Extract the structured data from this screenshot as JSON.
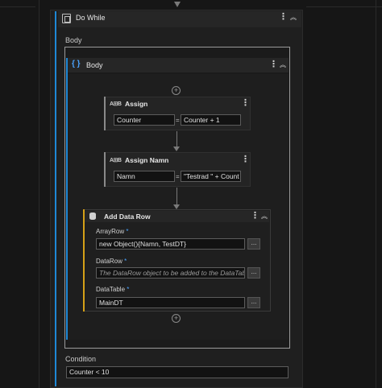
{
  "do_while": {
    "title": "Do While",
    "body_label": "Body",
    "condition_label": "Condition",
    "condition_value": "Counter < 10"
  },
  "body": {
    "title": "Body"
  },
  "assign1": {
    "title": "Assign",
    "left": "Counter",
    "eq": "=",
    "right": "Counter + 1"
  },
  "assign2": {
    "title": "Assign Namn",
    "left": "Namn",
    "eq": "=",
    "right": "\"Testrad \" + Count"
  },
  "add_data_row": {
    "title": "Add Data Row",
    "array_row_label": "ArrayRow",
    "array_row_value": "new Object(){Namn, TestDT}",
    "data_row_label": "DataRow",
    "data_row_placeholder": "The DataRow object to be added to the DataTabl",
    "data_table_label": "DataTable",
    "data_table_value": "MainDT",
    "required_marker": "*",
    "browse_label": "..."
  },
  "icons": {
    "kebab": "⋮",
    "collapse": "︽",
    "plus": "+",
    "assign_icon": "A⊞B",
    "body_icon": "{ }"
  },
  "colors": {
    "accent_blue": "#1e88d6",
    "accent_gold": "#d4a017",
    "background": "#161616"
  }
}
